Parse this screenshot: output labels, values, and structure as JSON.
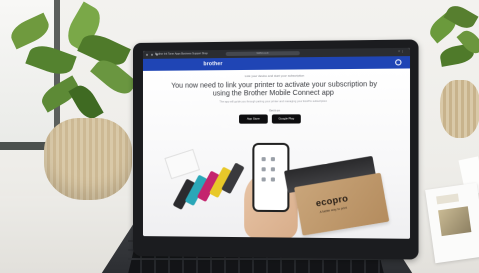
{
  "browser": {
    "tabs_text": "Brother  Ink  Toner  Apps  Business  Support  Shop",
    "address": "brother.co.uk",
    "toolbar_right": "☆  ⋮"
  },
  "site": {
    "brand": "brother",
    "breadcrumb": "Link your device and start your subscription",
    "headline": "You now need to link your printer to activate your subscription by using the Brother Mobile Connect app",
    "subtext": "The app will guide you through pairing your printer and managing your EcoPro subscription",
    "get_it_on": "Get it on",
    "app_store_label": "App Store",
    "google_play_label": "Google Play"
  },
  "ecopro_box": {
    "logo": "ecopro",
    "tagline": "A better way to print"
  },
  "colors": {
    "brand_blue": "#1f45b5",
    "browser_chrome": "#2b2d31",
    "box_kraft": "#c9a57a"
  },
  "icons": [
    "browser-dot-icon",
    "account-icon"
  ]
}
